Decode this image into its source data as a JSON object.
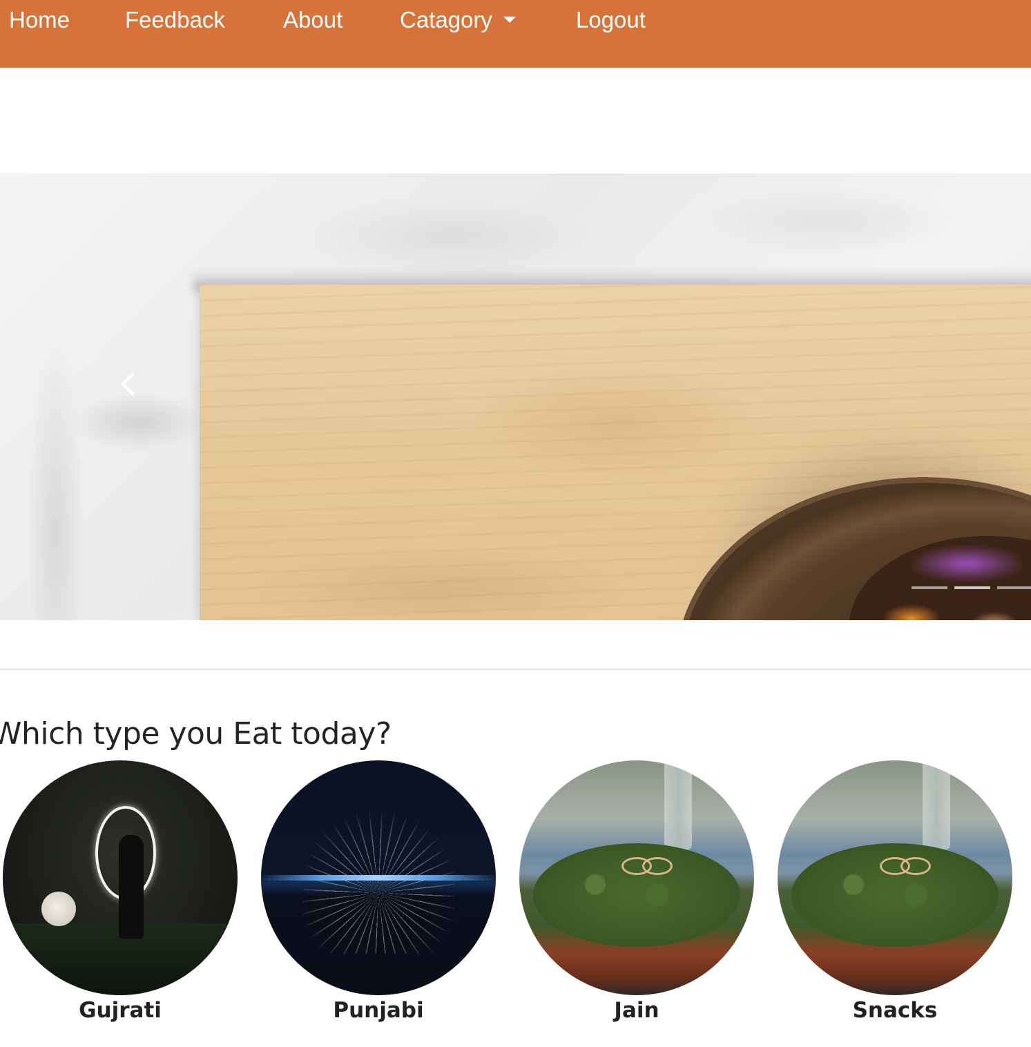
{
  "nav": {
    "items": [
      {
        "label": "Home"
      },
      {
        "label": "Feedback"
      },
      {
        "label": "About"
      },
      {
        "label": "Catagory",
        "has_dropdown": true
      },
      {
        "label": "Logout"
      }
    ],
    "background_color": "#d6733a",
    "text_color": "#ffffff"
  },
  "carousel": {
    "prev_icon": "chevron-left-icon",
    "slide_count": 3,
    "active_slide": 1
  },
  "section": {
    "title": "Which type you Eat today?"
  },
  "categories": [
    {
      "label": "Gujrati"
    },
    {
      "label": "Punjabi"
    },
    {
      "label": "Jain"
    },
    {
      "label": "Snacks"
    }
  ]
}
